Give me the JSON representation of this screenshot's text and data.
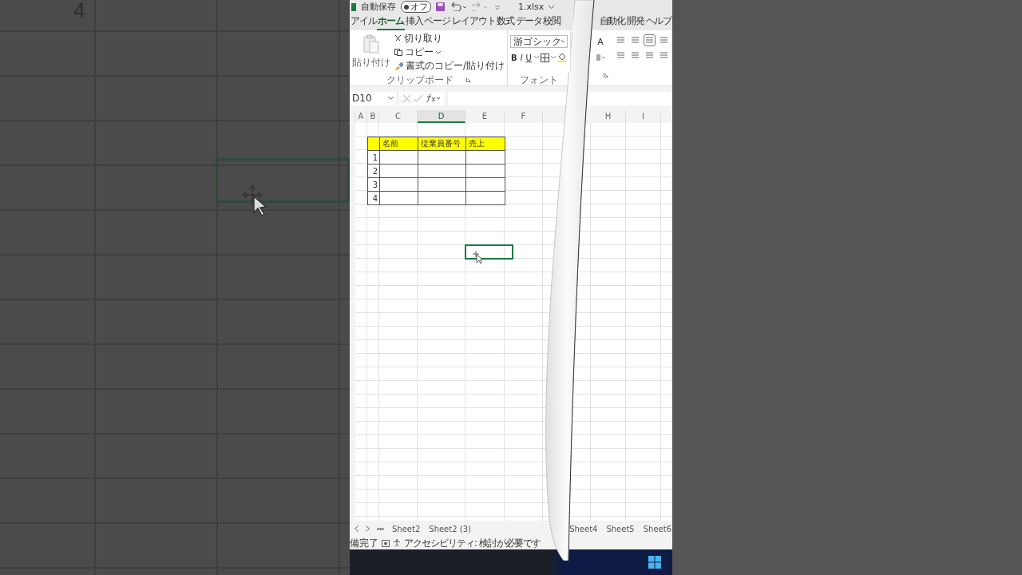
{
  "background": {
    "row_number": "4"
  },
  "title_bar": {
    "autosave_label": "自動保存",
    "autosave_toggle": {
      "label": "オフ",
      "on": false
    },
    "filename": "1.xlsx"
  },
  "ribbon_tabs": [
    {
      "label": "アイル",
      "selected": false
    },
    {
      "label": "ホーム",
      "selected": true
    },
    {
      "label": "挿入",
      "selected": false
    },
    {
      "label": "ページ レイアウト",
      "selected": false
    },
    {
      "label": "数式",
      "selected": false
    },
    {
      "label": "データ",
      "selected": false
    },
    {
      "label": "校閲",
      "selected": false
    },
    {
      "label": "自動化",
      "selected": false
    },
    {
      "label": "開発",
      "selected": false
    },
    {
      "label": "ヘルプ",
      "selected": false
    }
  ],
  "clipboard": {
    "paste": "貼り付け",
    "cut": "切り取り",
    "copy": "コピー",
    "format_painter": "書式のコピー/貼り付け",
    "group_label": "クリップボード"
  },
  "font": {
    "font_name": "游ゴシック",
    "bold": "B",
    "italic": "I",
    "underline": "U",
    "grow": "A",
    "group_label": "フォント"
  },
  "formula_bar": {
    "name_box": "D10"
  },
  "columns": [
    "A",
    "B",
    "C",
    "D",
    "E",
    "F",
    "H",
    "I"
  ],
  "table": {
    "header": [
      "名前",
      "従業員番号",
      "売上"
    ],
    "rows": [
      "1",
      "2",
      "3",
      "4"
    ]
  },
  "sheet_tabs": [
    {
      "label": "Sheet2",
      "selected": false
    },
    {
      "label": "Sheet2 (3)",
      "selected": false
    },
    {
      "label": "Sheet4",
      "selected": false
    },
    {
      "label": "Sheet5",
      "selected": false
    },
    {
      "label": "Sheet6",
      "selected": false
    }
  ],
  "status_bar": {
    "ready": "備完了",
    "accessibility": "アクセシビリティ: 検討が必要です"
  }
}
